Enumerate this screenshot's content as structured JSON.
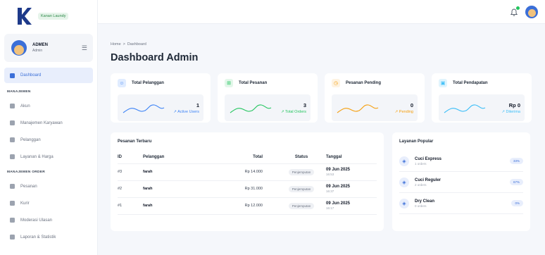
{
  "brand": {
    "name": "Kanan Laundy"
  },
  "user": {
    "name": "ADMEN",
    "role": "Admin"
  },
  "nav": {
    "dashboard": "Dashboard",
    "section_management": "MANAJEMEN",
    "items_management": [
      "Akun",
      "Manajemen Karyawan",
      "Pelanggan",
      "Layanan & Harga"
    ],
    "section_orders": "MANAJEMEN ORDER",
    "items_orders": [
      "Pesanan",
      "Kurir",
      "Moderasi Ulasan",
      "Laporan & Statistik"
    ]
  },
  "breadcrumb": {
    "home": "Home",
    "separator": ">",
    "current": "Dashboard"
  },
  "page_title": "Dashboard Admin",
  "stats": [
    {
      "title": "Total Pelanggan",
      "value": "1",
      "sub": "↗ Active Users",
      "icon": "users-icon",
      "color": "#3b82f6"
    },
    {
      "title": "Total Pesanan",
      "value": "3",
      "sub": "↗ Total Orders",
      "icon": "cart-icon",
      "color": "#22c55e"
    },
    {
      "title": "Pesanan Pending",
      "value": "0",
      "sub": "↗ Pending",
      "icon": "clock-icon",
      "color": "#f59e0b"
    },
    {
      "title": "Total Pendapatan",
      "value": "Rp 0",
      "sub": "↗ Diterima",
      "icon": "wallet-icon",
      "color": "#38bdf8"
    }
  ],
  "orders": {
    "title": "Pesanan Terbaru",
    "headers": [
      "ID",
      "Pelanggan",
      "Total",
      "Status",
      "Tanggal"
    ],
    "rows": [
      {
        "id": "#3",
        "customer": "farah",
        "total": "Rp 14.000",
        "status": "Penjemputan",
        "date": "09 Jun 2025",
        "time": "16:53"
      },
      {
        "id": "#2",
        "customer": "farah",
        "total": "Rp 31.000",
        "status": "Penjemputan",
        "date": "09 Jun 2025",
        "time": "16:37"
      },
      {
        "id": "#1",
        "customer": "farah",
        "total": "Rp 12.000",
        "status": "Penjemputan",
        "date": "09 Jun 2025",
        "time": "16:17"
      }
    ]
  },
  "popular": {
    "title": "Layanan Popular",
    "items": [
      {
        "name": "Cuci Express",
        "count": "1 orders",
        "pct": "33%"
      },
      {
        "name": "Cuci Reguler",
        "count": "2 orders",
        "pct": "67%"
      },
      {
        "name": "Dry Clean",
        "count": "0 orders",
        "pct": "0%"
      }
    ]
  }
}
